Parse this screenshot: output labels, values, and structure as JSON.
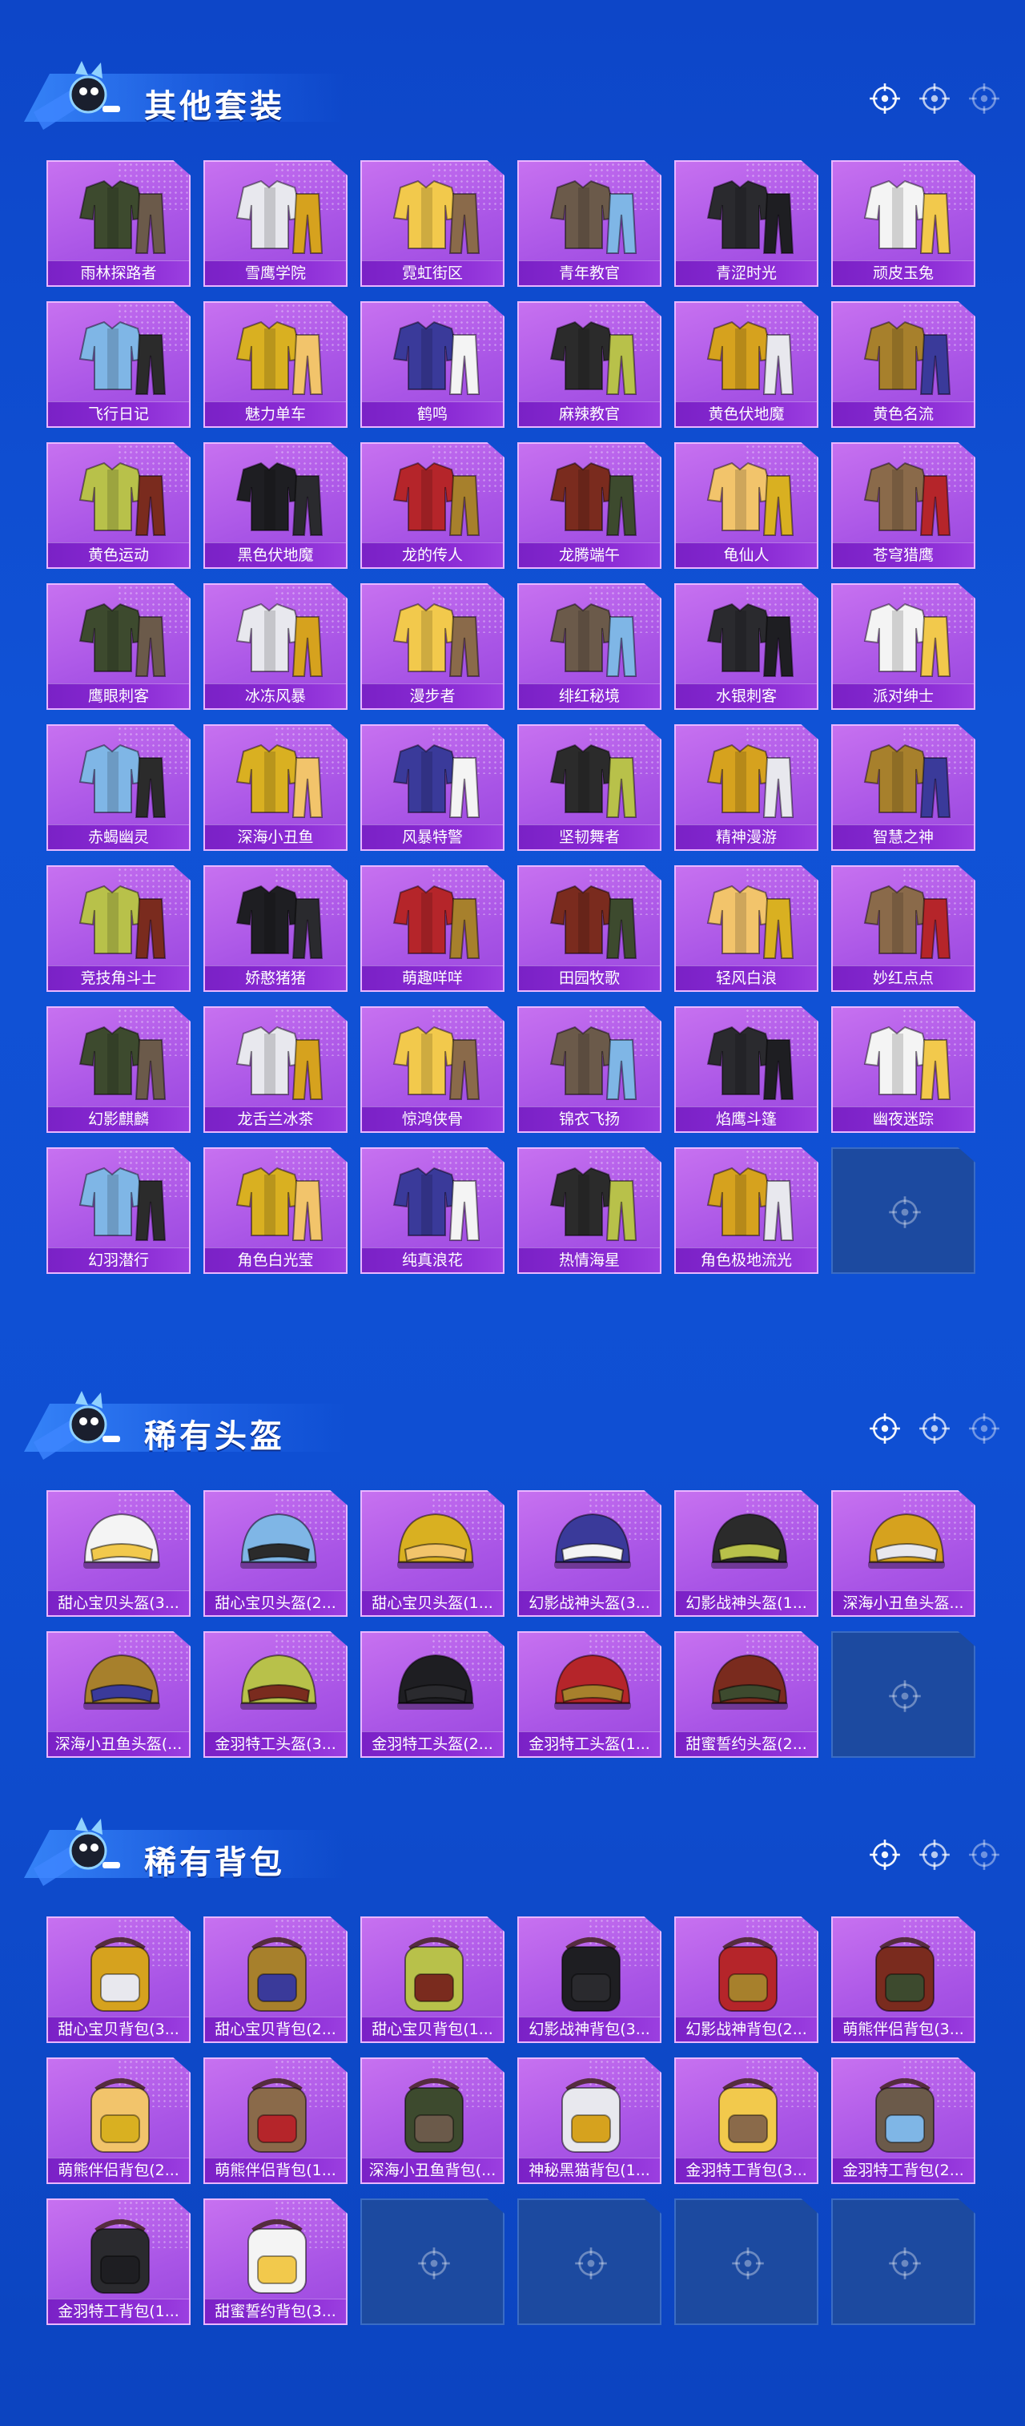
{
  "icons": {
    "mascot": "mascot-icon",
    "target": "crosshair-icon",
    "placeholder": "crosshair-placeholder-icon"
  },
  "colors": {
    "background": "#0f4fd3",
    "card": "#b15fe9",
    "card_label": "#8228cc",
    "empty_card": "#1c4aa0",
    "title": "#ffffff"
  },
  "sections": [
    {
      "id": "outfits",
      "title": "其他套装",
      "kind": "outfit",
      "items": [
        "雨林探路者",
        "雪鹰学院",
        "霓虹街区",
        "青年教官",
        "青涩时光",
        "顽皮玉兔",
        "飞行日记",
        "魅力单车",
        "鹤鸣",
        "麻辣教官",
        "黄色伏地魔",
        "黄色名流",
        "黄色运动",
        "黑色伏地魔",
        "龙的传人",
        "龙腾端午",
        "龟仙人",
        "苍穹猎鹰",
        "鹰眼刺客",
        "冰冻风暴",
        "漫步者",
        "绯红秘境",
        "水银刺客",
        "派对绅士",
        "赤蝎幽灵",
        "深海小丑鱼",
        "风暴特警",
        "坚韧舞者",
        "精神漫游",
        "智慧之神",
        "竞技角斗士",
        "娇憨猪猪",
        "萌趣咩咩",
        "田园牧歌",
        "轻风白浪",
        "妙红点点",
        "幻影麒麟",
        "龙舌兰冰茶",
        "惊鸿侠骨",
        "锦衣飞扬",
        "焰鹰斗篷",
        "幽夜迷踪",
        "幻羽潜行",
        "角色白光莹",
        "纯真浪花",
        "热情海星",
        "角色极地流光"
      ],
      "empty_slots": 1
    },
    {
      "id": "helmets",
      "title": "稀有头盔",
      "kind": "helmet",
      "items": [
        "甜心宝贝头盔(3...",
        "甜心宝贝头盔(2...",
        "甜心宝贝头盔(1...",
        "幻影战神头盔(3...",
        "幻影战神头盔(1...",
        "深海小丑鱼头盔...",
        "深海小丑鱼头盔(...",
        "金羽特工头盔(3...",
        "金羽特工头盔(2...",
        "金羽特工头盔(1...",
        "甜蜜誓约头盔(2..."
      ],
      "empty_slots": 1
    },
    {
      "id": "backpacks",
      "title": "稀有背包",
      "kind": "backpack",
      "items": [
        "甜心宝贝背包(3...",
        "甜心宝贝背包(2...",
        "甜心宝贝背包(1...",
        "幻影战神背包(3...",
        "幻影战神背包(2...",
        "萌熊伴侣背包(3...",
        "萌熊伴侣背包(2...",
        "萌熊伴侣背包(1...",
        "深海小丑鱼背包(...",
        "神秘黑猫背包(1...",
        "金羽特工背包(3...",
        "金羽特工背包(2...",
        "金羽特工背包(1...",
        "甜蜜誓约背包(3..."
      ],
      "empty_slots": 4
    }
  ]
}
